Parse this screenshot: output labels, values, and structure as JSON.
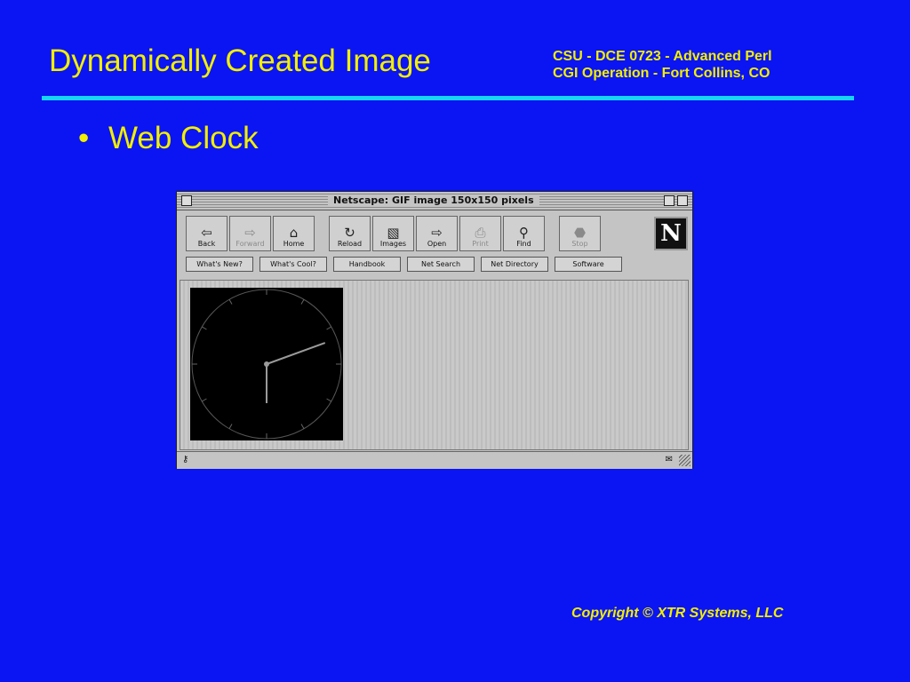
{
  "slide": {
    "title": "Dynamically Created Image",
    "course_line1": "CSU - DCE 0723 - Advanced Perl",
    "course_line2": "CGI Operation - Fort Collins, CO",
    "bullet_symbol": "•",
    "bullet": "Web Clock",
    "copyright": "Copyright © XTR Systems, LLC"
  },
  "colors": {
    "background": "#0b14f2",
    "text": "#f2ef00",
    "rule": "#16d6f7"
  },
  "browser": {
    "window_title": "Netscape: GIF image 150x150 pixels",
    "logo_letter": "N",
    "toolbar": [
      {
        "label": "Back",
        "icon": "back-arrow-icon",
        "glyph": "⇦",
        "enabled": true
      },
      {
        "label": "Forward",
        "icon": "forward-arrow-icon",
        "glyph": "⇨",
        "enabled": false
      },
      {
        "label": "Home",
        "icon": "home-icon",
        "glyph": "⌂",
        "enabled": true
      },
      {
        "label": "Reload",
        "icon": "reload-icon",
        "glyph": "↻",
        "enabled": true
      },
      {
        "label": "Images",
        "icon": "images-icon",
        "glyph": "▧",
        "enabled": true
      },
      {
        "label": "Open",
        "icon": "open-icon",
        "glyph": "⇨",
        "enabled": true
      },
      {
        "label": "Print",
        "icon": "print-icon",
        "glyph": "⎙",
        "enabled": false
      },
      {
        "label": "Find",
        "icon": "find-icon",
        "glyph": "⚲",
        "enabled": true
      },
      {
        "label": "Stop",
        "icon": "stop-icon",
        "glyph": "⬣",
        "enabled": false
      }
    ],
    "directory_buttons": [
      "What's New?",
      "What's Cool?",
      "Handbook",
      "Net Search",
      "Net Directory",
      "Software"
    ],
    "status_left_icon": "security-key-icon",
    "status_right_icon": "mail-icon"
  },
  "clock": {
    "hour_hand_angle_deg": 180,
    "minute_hand_angle_deg": 70,
    "face_color": "#000000",
    "hand_color": "#9a9a9a"
  }
}
